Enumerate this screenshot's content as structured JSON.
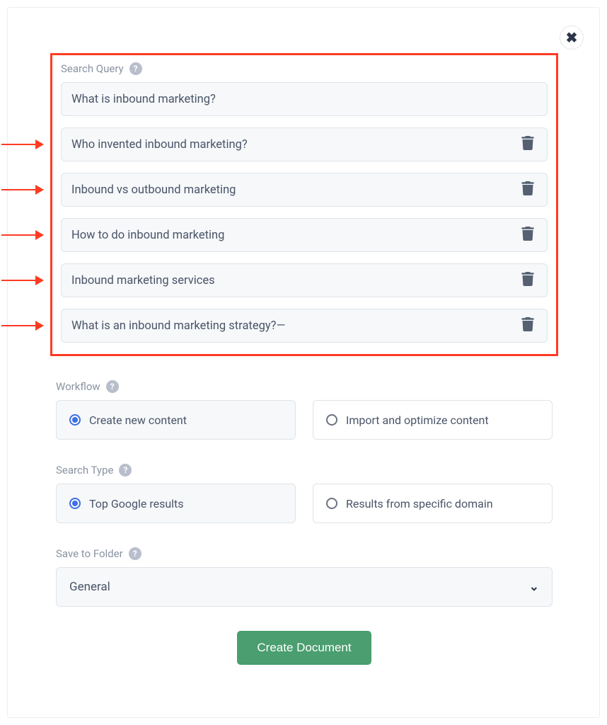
{
  "labels": {
    "search_query": "Search Query",
    "workflow": "Workflow",
    "search_type": "Search Type",
    "save_to_folder": "Save to Folder"
  },
  "queries": [
    {
      "text": "What is inbound marketing?",
      "deletable": false,
      "arrow": false
    },
    {
      "text": "Who invented inbound marketing?",
      "deletable": true,
      "arrow": true
    },
    {
      "text": "Inbound vs outbound marketing",
      "deletable": true,
      "arrow": true
    },
    {
      "text": "How to do inbound marketing",
      "deletable": true,
      "arrow": true
    },
    {
      "text": "Inbound marketing services",
      "deletable": true,
      "arrow": true
    },
    {
      "text": "What is an inbound marketing strategy?—",
      "deletable": true,
      "arrow": true
    }
  ],
  "workflow": {
    "options": [
      {
        "label": "Create new content",
        "selected": true
      },
      {
        "label": "Import and optimize content",
        "selected": false
      }
    ]
  },
  "search_type": {
    "options": [
      {
        "label": "Top Google results",
        "selected": true
      },
      {
        "label": "Results from specific domain",
        "selected": false
      }
    ]
  },
  "folder": {
    "selected": "General"
  },
  "buttons": {
    "create_document": "Create Document"
  },
  "help_glyph": "?"
}
